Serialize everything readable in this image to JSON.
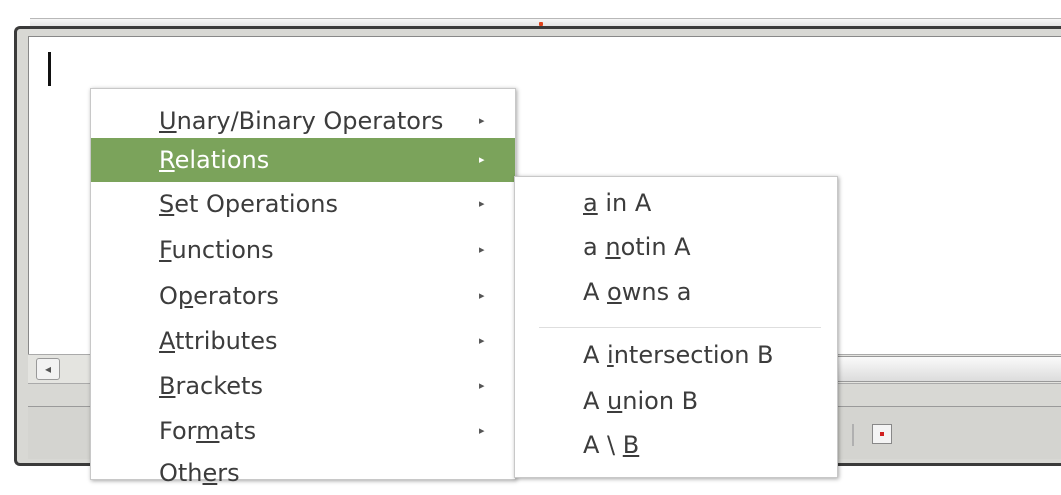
{
  "colors": {
    "highlight": "#7ba35b",
    "menu_text": "#3c3c3c",
    "title_dot": "#e0431b"
  },
  "scrollbar": {
    "left_arrow": "◂"
  },
  "menu": {
    "items": [
      {
        "pre": "",
        "u": "U",
        "post": "nary/Binary Operators",
        "arrow": "▸"
      },
      {
        "pre": "",
        "u": "R",
        "post": "elations",
        "arrow": "▸"
      },
      {
        "pre": "",
        "u": "S",
        "post": "et Operations",
        "arrow": "▸"
      },
      {
        "pre": "",
        "u": "F",
        "post": "unctions",
        "arrow": "▸"
      },
      {
        "pre": "O",
        "u": "p",
        "post": "erators",
        "arrow": "▸"
      },
      {
        "pre": "",
        "u": "A",
        "post": "ttributes",
        "arrow": "▸"
      },
      {
        "pre": "",
        "u": "B",
        "post": "rackets",
        "arrow": "▸"
      },
      {
        "pre": "For",
        "u": "m",
        "post": "ats",
        "arrow": "▸"
      },
      {
        "pre": "Oth",
        "u": "e",
        "post": "rs",
        "arrow": ""
      }
    ]
  },
  "submenu": {
    "items": [
      {
        "pre": "",
        "u": "a",
        "post": " in A"
      },
      {
        "pre": "a ",
        "u": "n",
        "post": "otin A"
      },
      {
        "pre": "A ",
        "u": "o",
        "post": "wns a"
      },
      {
        "pre": "A ",
        "u": "i",
        "post": "ntersection B"
      },
      {
        "pre": "A ",
        "u": "u",
        "post": "nion B"
      },
      {
        "pre": "A \\ ",
        "u": "B",
        "post": ""
      }
    ]
  }
}
